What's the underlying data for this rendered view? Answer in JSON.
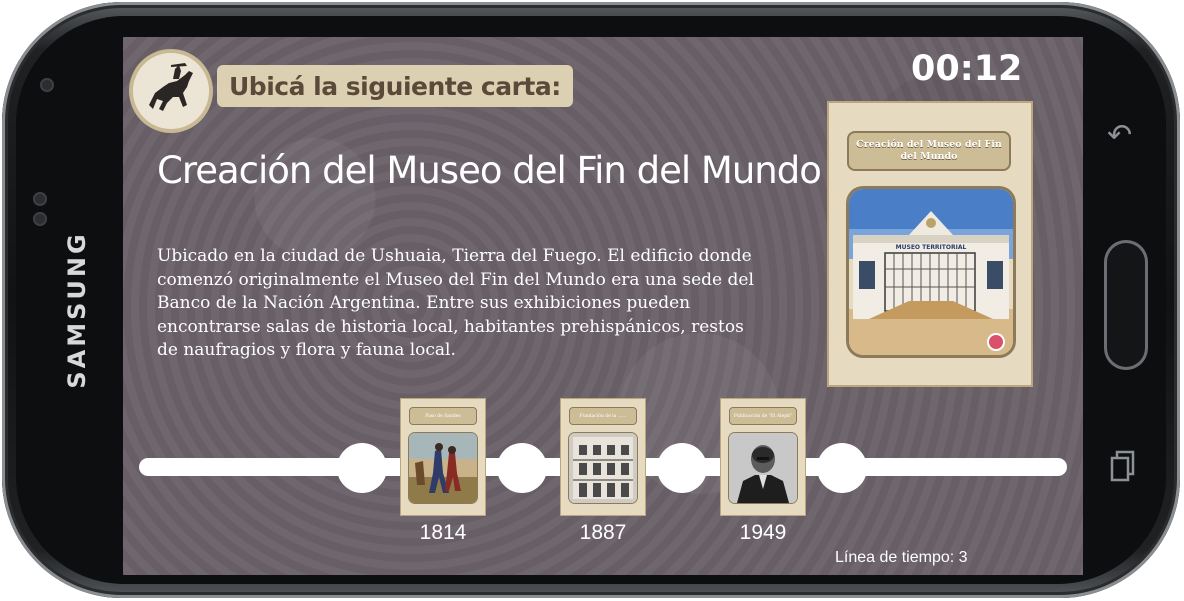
{
  "device": {
    "brand": "SAMSUNG"
  },
  "header": {
    "prompt": "Ubicá la siguiente carta:",
    "timer": "00:12"
  },
  "current_card": {
    "title": "Creación del Museo del Fin del Mundo",
    "description": "Ubicado en la ciudad de Ushuaia, Tierra del Fuego. El edificio donde comenzó originalmente el Museo del Fin del Mundo era una sede del Banco de la Nación Argentina. Entre sus exhibiciones pueden encontrarse salas de historia local, habitantes prehispánicos, restos de naufragios y flora y fauna local.",
    "card_title": "Creación del Museo del Fin del Mundo",
    "building_sign": "MUSEO TERRITORIAL"
  },
  "timeline": {
    "cards": [
      {
        "label": "Paso de Sandes",
        "year": "1814"
      },
      {
        "label": "Fundación de la ......",
        "year": "1887"
      },
      {
        "label": "Publicación de \"El Aleph\"",
        "year": "1949"
      }
    ],
    "counter": "Línea de tiempo: 3"
  },
  "colors": {
    "background": "#6a6169",
    "card": "#e6dbc0",
    "prompt_bg": "#dcd0b2",
    "accent_dot": "#d9506b"
  },
  "icons": [
    "horse-rider-icon",
    "back-icon",
    "recents-icon"
  ]
}
